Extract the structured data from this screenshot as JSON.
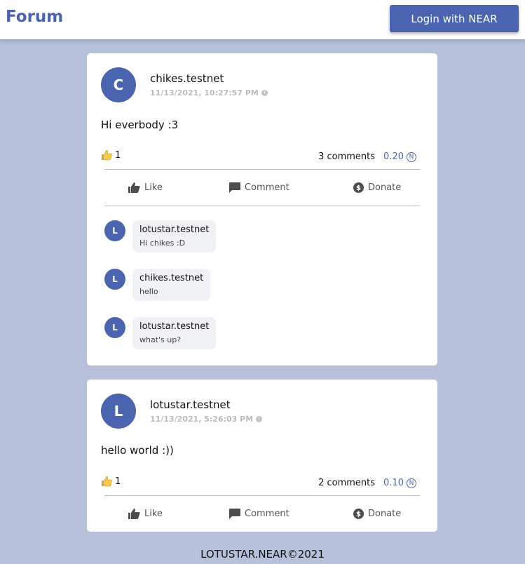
{
  "header": {
    "brand": "Forum",
    "login_label": "Login with NEAR"
  },
  "posts": [
    {
      "avatar_letter": "C",
      "author": "chikes.testnet",
      "timestamp": "11/13/2021, 10:27:57 PM",
      "body": "Hi everbody :3",
      "likes": "1",
      "comments_count": "3 comments",
      "amount": "0.20",
      "actions": {
        "like": "Like",
        "comment": "Comment",
        "donate": "Donate"
      },
      "comments": [
        {
          "avatar_letter": "L",
          "author": "lotustar.testnet",
          "text": "Hi chikes :D"
        },
        {
          "avatar_letter": "L",
          "author": "chikes.testnet",
          "text": "hello"
        },
        {
          "avatar_letter": "L",
          "author": "lotustar.testnet",
          "text": "what's up?"
        }
      ]
    },
    {
      "avatar_letter": "L",
      "author": "lotustar.testnet",
      "timestamp": "11/13/2021, 5:26:03 PM",
      "body": "hello world :))",
      "likes": "1",
      "comments_count": "2 comments",
      "amount": "0.10",
      "actions": {
        "like": "Like",
        "comment": "Comment",
        "donate": "Donate"
      }
    }
  ],
  "footer": {
    "text": "LOTUSTAR.NEAR©2021"
  },
  "colors": {
    "accent": "#4a64b0",
    "background": "#b6c0da"
  },
  "icons": {
    "clock": "clock-icon",
    "near": "near-token-icon",
    "like": "thumbs-up-icon",
    "comment": "comment-icon",
    "donate": "dollar-coin-icon"
  }
}
